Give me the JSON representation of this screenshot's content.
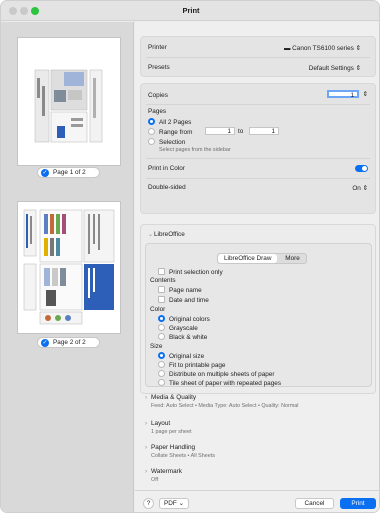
{
  "window": {
    "title": "Print"
  },
  "sidebar": {
    "pages": [
      {
        "label": "Page 1 of 2"
      },
      {
        "label": "Page 2 of 2"
      }
    ]
  },
  "printer": {
    "label": "Printer",
    "value": "Canon TS6100 series"
  },
  "presets": {
    "label": "Presets",
    "value": "Default Settings"
  },
  "copies": {
    "label": "Copies",
    "value": "1"
  },
  "pages": {
    "label": "Pages",
    "all_label": "All 2 Pages",
    "range_label": "Range from",
    "range_from": "1",
    "range_to_label": "to",
    "range_to": "1",
    "selection_label": "Selection",
    "selection_hint": "Select pages from the sidebar"
  },
  "print_in_color": {
    "label": "Print in Color"
  },
  "double_sided": {
    "label": "Double-sided",
    "value": "On"
  },
  "libreoffice": {
    "title": "LibreOffice",
    "tabs": [
      "LibreOffice Draw",
      "More"
    ],
    "print_selection_only": "Print selection only",
    "contents": {
      "title": "Contents",
      "items": [
        "Page name",
        "Date and time"
      ]
    },
    "color": {
      "title": "Color",
      "items": [
        "Original colors",
        "Grayscale",
        "Black & white"
      ]
    },
    "size": {
      "title": "Size",
      "items": [
        "Original size",
        "Fit to printable page",
        "Distribute on multiple sheets of paper",
        "Tile sheet of paper with repeated pages"
      ]
    }
  },
  "sections": [
    {
      "title": "Media & Quality",
      "summary": "Feed: Auto Select • Media Type: Auto Select • Quality: Normal"
    },
    {
      "title": "Layout",
      "summary": "1 page per sheet"
    },
    {
      "title": "Paper Handling",
      "summary": "Collate Sheets • All Sheets"
    },
    {
      "title": "Watermark",
      "summary": "Off"
    }
  ],
  "footer": {
    "help": "?",
    "pdf": "PDF",
    "cancel": "Cancel",
    "print": "Print"
  },
  "colors": {
    "accent": "#0a6ff0",
    "traffic_green": "#2ac43f"
  }
}
